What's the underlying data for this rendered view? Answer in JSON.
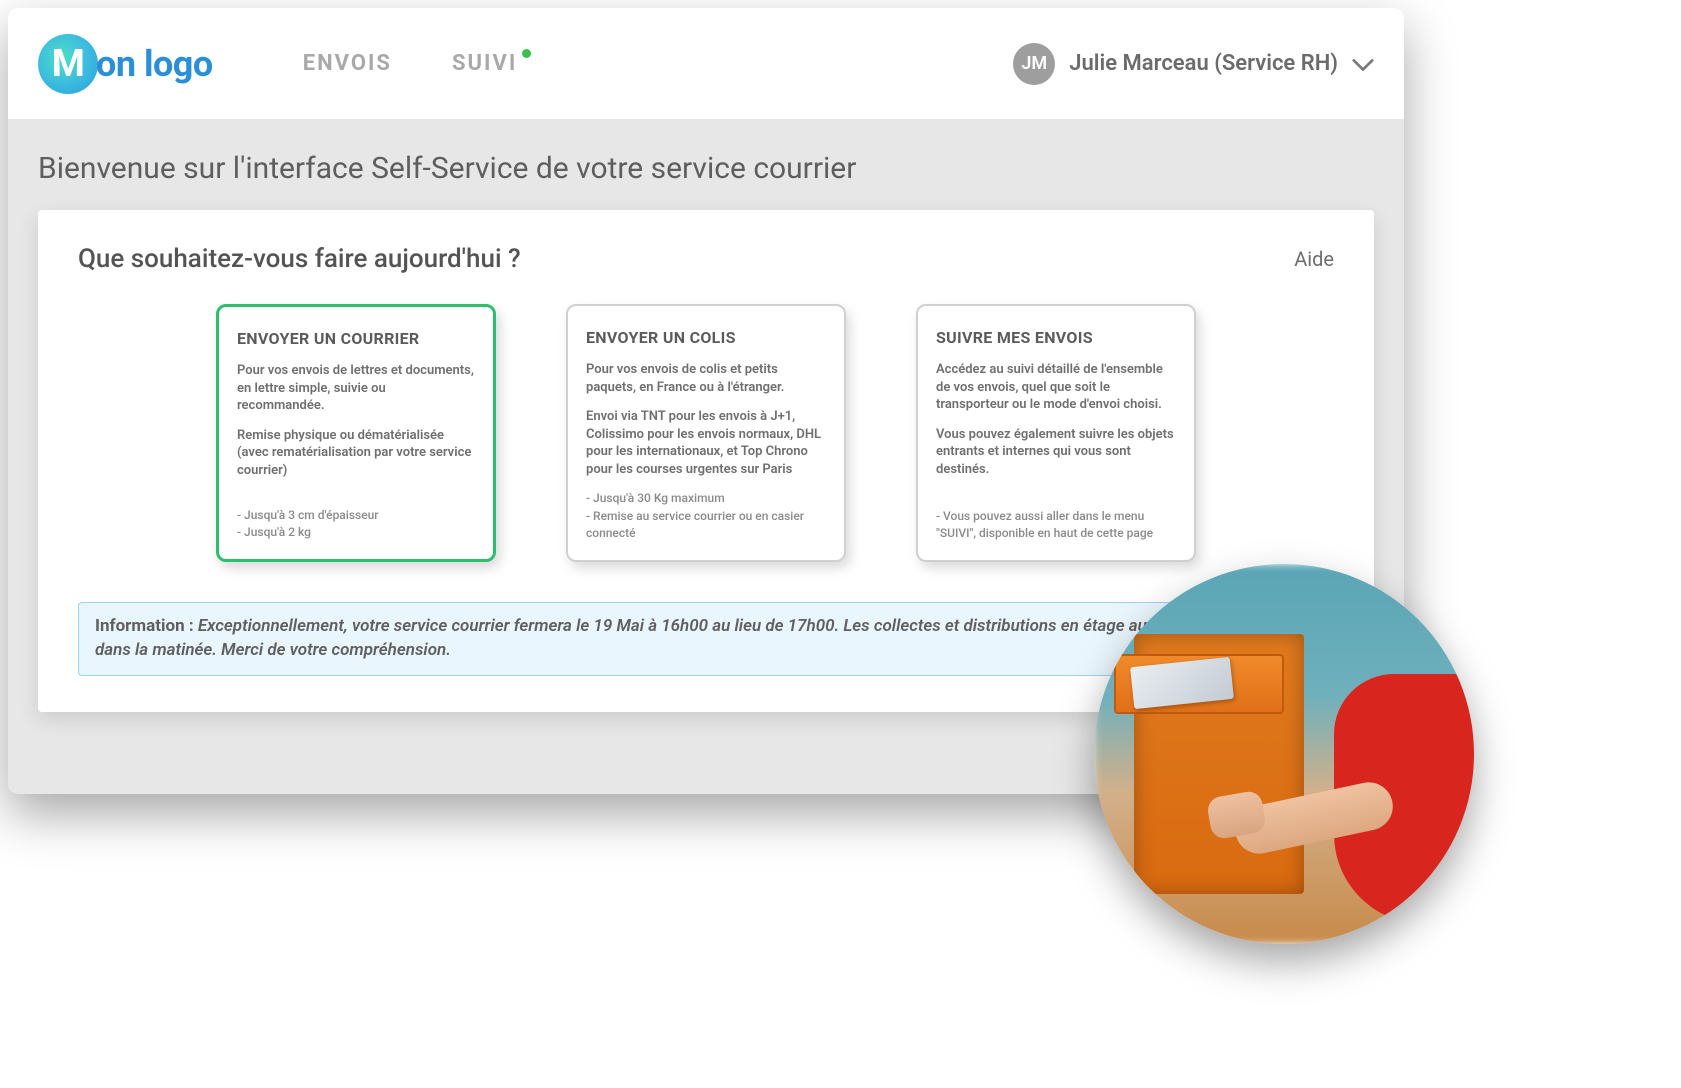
{
  "header": {
    "logo_letter": "M",
    "logo_rest": "on logo",
    "nav": [
      {
        "label": "ENVOIS",
        "has_dot": false
      },
      {
        "label": "SUIVI",
        "has_dot": true
      }
    ],
    "user": {
      "initials": "JM",
      "display": "Julie Marceau (Service RH)"
    }
  },
  "page": {
    "title": "Bienvenue sur l'interface Self-Service de votre service courrier",
    "card_title": "Que souhaitez-vous faire aujourd'hui ?",
    "help_label": "Aide"
  },
  "options": [
    {
      "title": "ENVOYER UN COURRIER",
      "desc1": "Pour vos envois de lettres et documents, en lettre simple, suivie ou recommandée.",
      "desc2": "Remise physique ou dématérialisée (avec rematérialisation par votre service courrier)",
      "meta": "- Jusqu'à 3 cm d'épaisseur\n- Jusqu'à 2 kg",
      "selected": true
    },
    {
      "title": "ENVOYER UN COLIS",
      "desc1": "Pour vos envois de colis et petits paquets, en France ou à l'étranger.",
      "desc2": "Envoi via TNT pour les envois à J+1, Colissimo pour les envois normaux, DHL pour les internationaux, et Top Chrono pour les courses urgentes sur Paris",
      "meta": "- Jusqu'à 30 Kg maximum\n- Remise au service courrier ou en casier connecté",
      "selected": false
    },
    {
      "title": "SUIVRE MES ENVOIS",
      "desc1": "Accédez au suivi détaillé de l'ensemble de vos envois, quel que soit le transporteur ou le mode d'envoi choisi.",
      "desc2": "Vous pouvez également suivre les objets entrants et internes qui vous sont destinés.",
      "meta": "- Vous pouvez aussi aller dans le menu \"SUIVI\", disponible en haut de cette page",
      "selected": false
    }
  ],
  "info_banner": {
    "prefix": "Information : ",
    "body": "Exceptionnellement, votre service courrier fermera le 19 Mai à 16h00 au lieu de 17h00. Les collectes et distributions en étage auront lieu normalement dans la matinée. Merci de votre compréhension."
  }
}
